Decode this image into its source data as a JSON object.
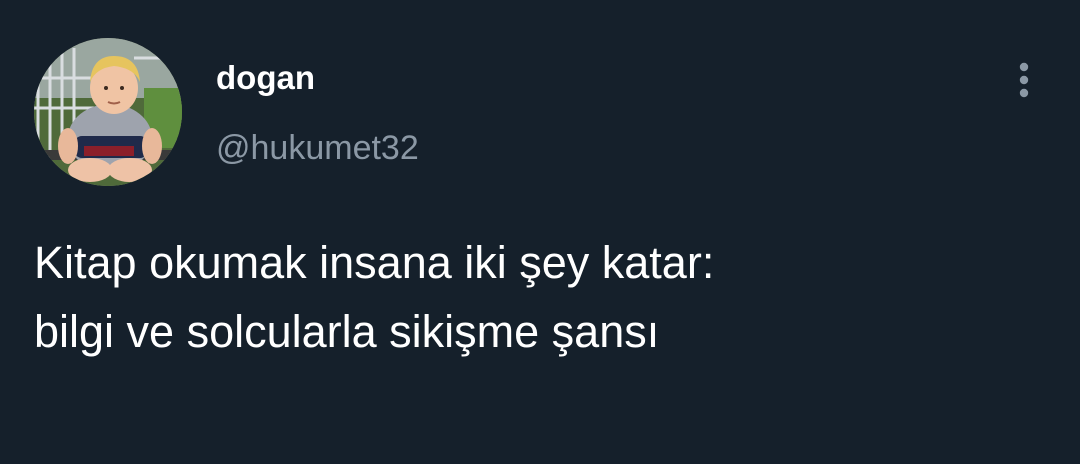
{
  "tweet": {
    "author": {
      "display_name": "dogan",
      "handle": "@hukumet32",
      "avatar_icon": "avatar-photo"
    },
    "text_lines": [
      "Kitap okumak insana iki şey katar:",
      "bilgi ve solcularla sikişme şansı"
    ],
    "more_icon": "more-vertical-icon"
  },
  "colors": {
    "background": "#15202b",
    "primary_text": "#ffffff",
    "secondary_text": "#8b98a5",
    "icon": "#8b98a5"
  }
}
